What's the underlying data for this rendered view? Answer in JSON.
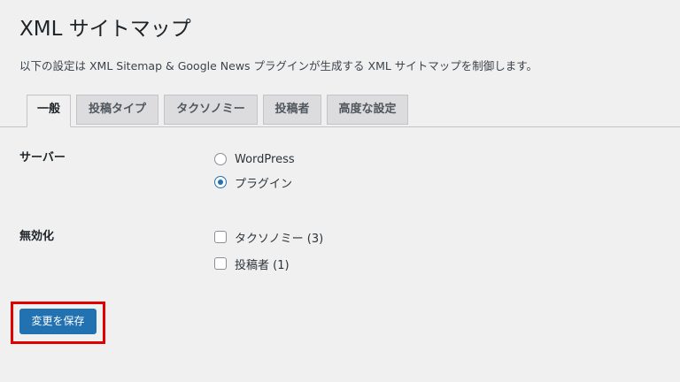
{
  "page": {
    "title": "XML サイトマップ",
    "description": "以下の設定は XML Sitemap & Google News プラグインが生成する XML サイトマップを制御します。"
  },
  "tabs": [
    {
      "label": "一般",
      "active": true
    },
    {
      "label": "投稿タイプ",
      "active": false
    },
    {
      "label": "タクソノミー",
      "active": false
    },
    {
      "label": "投稿者",
      "active": false
    },
    {
      "label": "高度な設定",
      "active": false
    }
  ],
  "server": {
    "label": "サーバー",
    "options": [
      {
        "label": "WordPress",
        "checked": false
      },
      {
        "label": "プラグイン",
        "checked": true
      }
    ]
  },
  "disable": {
    "label": "無効化",
    "options": [
      {
        "label": "タクソノミー (3)",
        "checked": false
      },
      {
        "label": "投稿者 (1)",
        "checked": false
      }
    ]
  },
  "submit": {
    "label": "変更を保存"
  },
  "colors": {
    "accent": "#2271b1",
    "highlight": "#e00000",
    "background": "#f0f0f1"
  }
}
